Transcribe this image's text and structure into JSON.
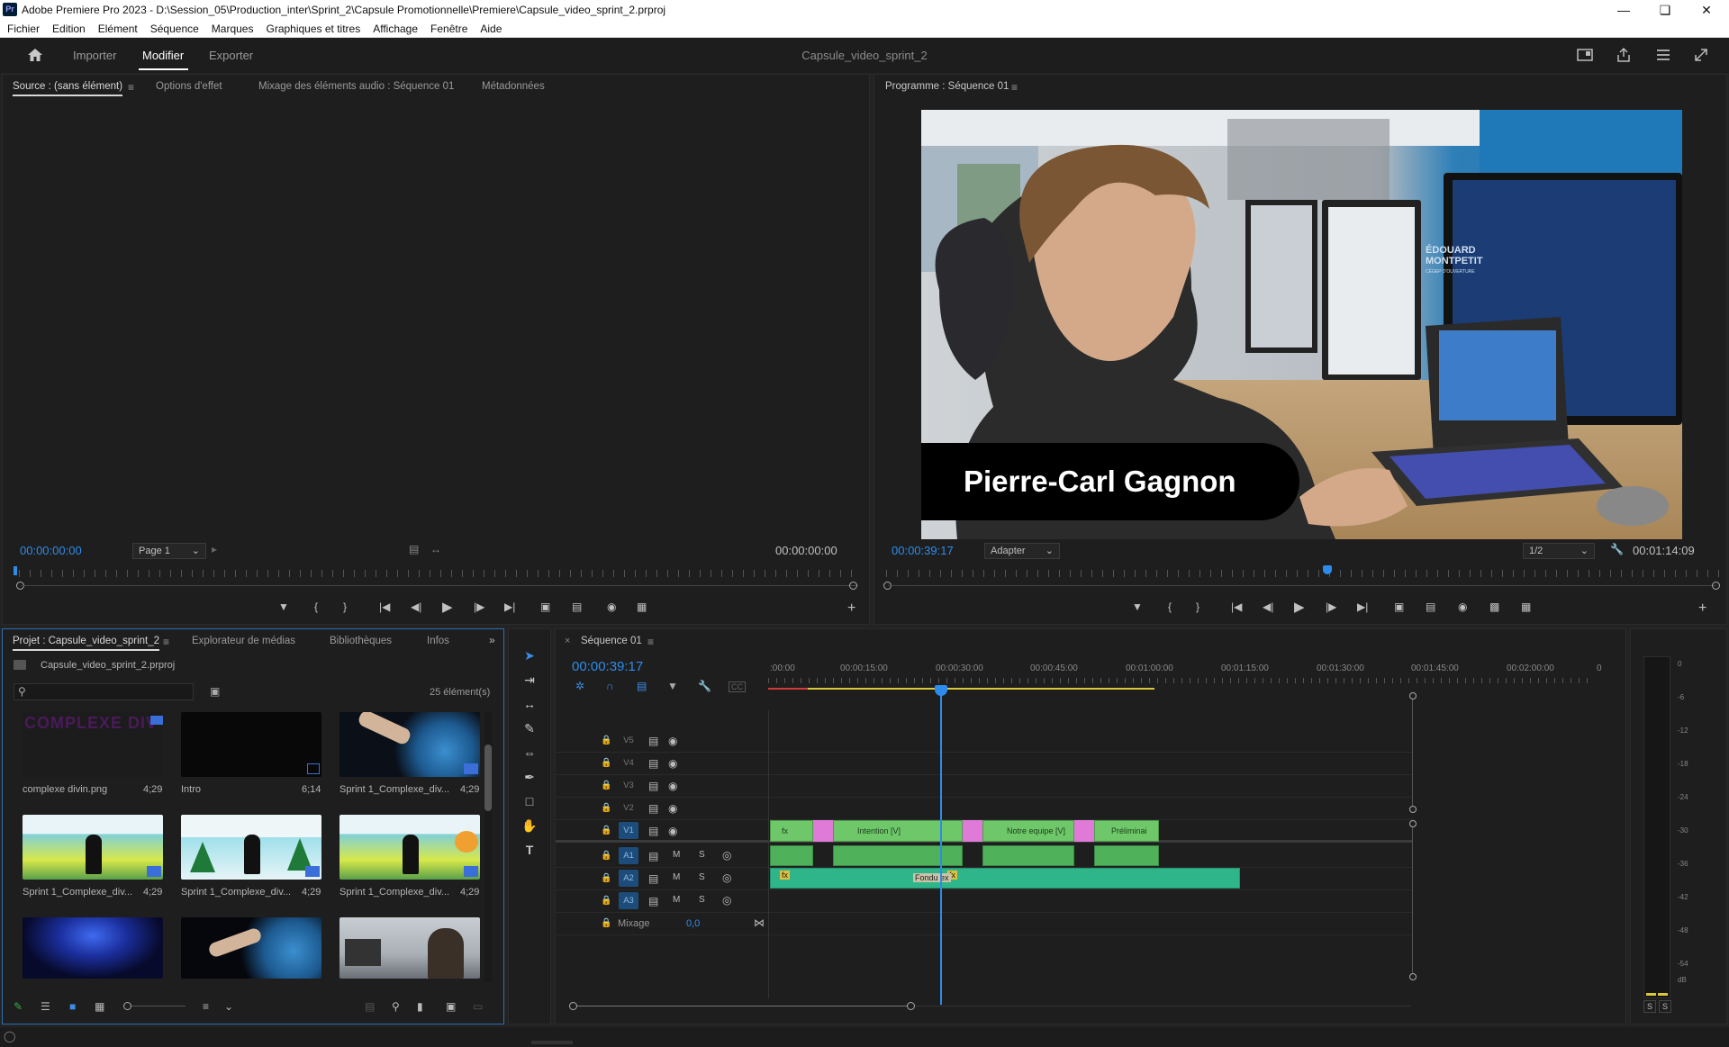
{
  "app": {
    "title": "Adobe Premiere Pro 2023 - D:\\Session_05\\Production_inter\\Sprint_2\\Capsule Promotionnelle\\Premiere\\Capsule_video_sprint_2.prproj",
    "logo": "Pr"
  },
  "menu": [
    "Fichier",
    "Edition",
    "Elément",
    "Séquence",
    "Marques",
    "Graphiques et titres",
    "Affichage",
    "Fenêtre",
    "Aide"
  ],
  "header": {
    "home_icon": "home-icon",
    "nav": [
      "Importer",
      "Modifier",
      "Exporter"
    ],
    "active_nav": "Modifier",
    "project_name": "Capsule_video_sprint_2"
  },
  "source_panel": {
    "tabs": [
      "Source : (sans élément)",
      "Options d'effet",
      "Mixage des éléments audio : Séquence 01",
      "Métadonnées"
    ],
    "timecode_left": "00:00:00:00",
    "page_select": "Page 1",
    "timecode_right": "00:00:00:00"
  },
  "program_panel": {
    "tab": "Programme : Séquence 01",
    "lower_third": "Pierre-Carl Gagnon",
    "monitor_logo_line1": "ÉDOUARD",
    "monitor_logo_line2": "MONTPETIT",
    "monitor_logo_line3": "CÉGEP D'OUVERTURE",
    "timecode": "00:00:39:17",
    "fit_select": "Adapter",
    "resolution_select": "1/2",
    "duration": "00:01:14:09",
    "playhead_position": 0.53
  },
  "project_panel": {
    "tabs": [
      "Projet : Capsule_video_sprint_2",
      "Explorateur de médias",
      "Bibliothèques",
      "Infos"
    ],
    "file": "Capsule_video_sprint_2.prproj",
    "search_placeholder": "",
    "count": "25 élément(s)",
    "items": [
      {
        "name": "complexe divin.png",
        "duration": "4;29",
        "thumb_text": "COMPLEXE DIV"
      },
      {
        "name": "Intro",
        "duration": "6;14"
      },
      {
        "name": "Sprint 1_Complexe_div...",
        "duration": "4;29"
      },
      {
        "name": "Sprint 1_Complexe_div...",
        "duration": "4;29"
      },
      {
        "name": "Sprint 1_Complexe_div...",
        "duration": "4;29"
      },
      {
        "name": "Sprint 1_Complexe_div...",
        "duration": "4;29"
      },
      {
        "name": "",
        "duration": ""
      },
      {
        "name": "",
        "duration": ""
      },
      {
        "name": "",
        "duration": ""
      }
    ]
  },
  "timeline": {
    "tab": "Séquence 01",
    "timecode": "00:00:39:17",
    "ruler_labels": [
      ":00:00",
      "00:00:15:00",
      "00:00:30:00",
      "00:00:45:00",
      "00:01:00:00",
      "00:01:15:00",
      "00:01:30:00",
      "00:01:45:00",
      "00:02:00:00",
      "0"
    ],
    "video_tracks": [
      "V5",
      "V4",
      "V3",
      "V2",
      "V1"
    ],
    "audio_tracks": [
      "A1",
      "A2",
      "A3"
    ],
    "track_m": "M",
    "track_s": "S",
    "mix_label": "Mixage",
    "mix_value": "0,0",
    "clips": {
      "v1_a": "fx",
      "v1_b": "Intention [V]",
      "v1_c": "Notre equipe [V]",
      "v1_d": "Préliminai",
      "a2_fade": "Fondu ex",
      "a2_fx1": "fx",
      "a2_fx2": "fx"
    }
  },
  "meter": {
    "scale": [
      "0",
      "-6",
      "-12",
      "-18",
      "-24",
      "-30",
      "-36",
      "-42",
      "-48",
      "-54",
      "dB"
    ],
    "solo_left": "S",
    "solo_right": "S"
  }
}
